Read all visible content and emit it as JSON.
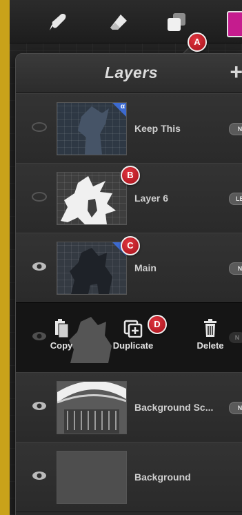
{
  "toolbar": {
    "tools": [
      {
        "icon": "brush-icon"
      },
      {
        "icon": "eraser-icon"
      },
      {
        "icon": "layers-icon"
      }
    ],
    "color_swatch": "#c51c8e"
  },
  "panel": {
    "title": "Layers",
    "add_label": "+"
  },
  "layers": [
    {
      "name": "Keep This",
      "blend": "N",
      "visible": false,
      "alpha_lock": true,
      "alpha_symbol": "α"
    },
    {
      "name": "Layer 6",
      "blend": "LB",
      "visible": false,
      "alpha_lock": false
    },
    {
      "name": "Main",
      "blend": "N",
      "visible": true,
      "alpha_lock": true,
      "alpha_symbol": "α"
    },
    {
      "name": "",
      "blend": "N",
      "visible": true,
      "alpha_lock": false
    },
    {
      "name": "Background Sc...",
      "blend": "N",
      "visible": true,
      "alpha_lock": false
    },
    {
      "name": "Background",
      "blend": "",
      "visible": true,
      "alpha_lock": false
    }
  ],
  "actions": {
    "copy": "Copy",
    "duplicate": "Duplicate",
    "delete": "Delete"
  },
  "callouts": {
    "a": "A",
    "b": "B",
    "c": "C",
    "d": "D"
  }
}
